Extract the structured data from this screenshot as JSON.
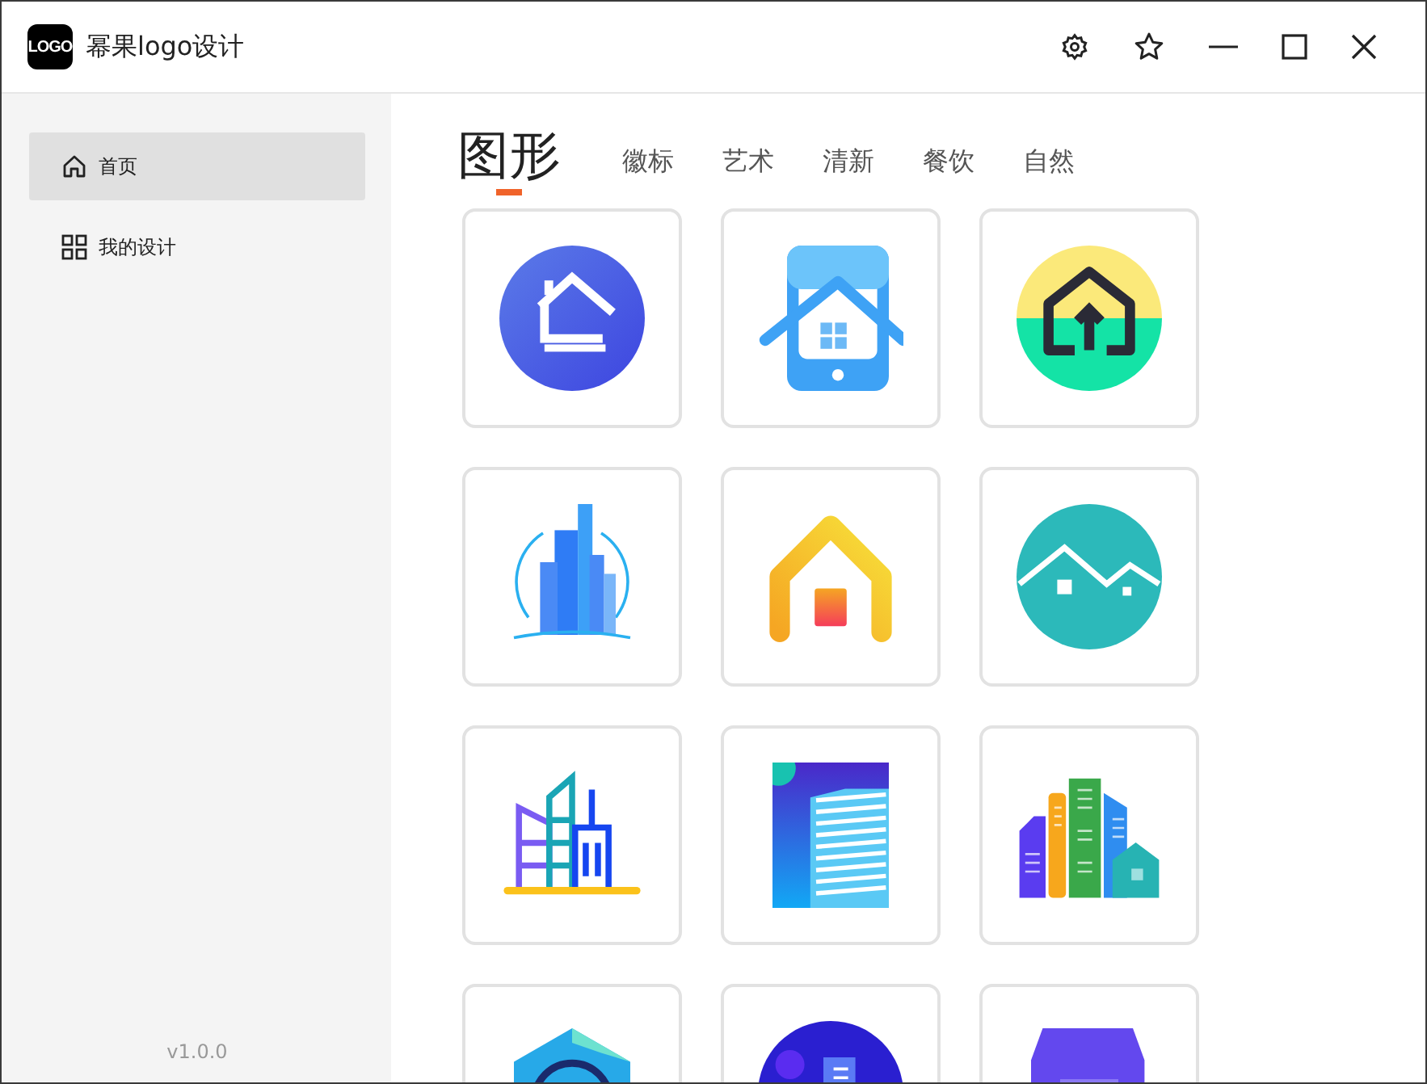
{
  "window": {
    "logo_text": "LOGO",
    "title": "幂果logo设计"
  },
  "sidebar": {
    "items": [
      {
        "label": "首页",
        "kind": "home",
        "selected": true
      },
      {
        "label": "我的设计",
        "kind": "grid",
        "selected": false
      }
    ],
    "version": "v1.0.0"
  },
  "tabs": [
    {
      "label": "图形",
      "selected": true
    },
    {
      "label": "徽标",
      "selected": false
    },
    {
      "label": "艺术",
      "selected": false
    },
    {
      "label": "清新",
      "selected": false
    },
    {
      "label": "餐饮",
      "selected": false
    },
    {
      "label": "自然",
      "selected": false
    }
  ],
  "templates": [
    {
      "kind": "house-circle"
    },
    {
      "kind": "phone-house"
    },
    {
      "kind": "house-arrow"
    },
    {
      "kind": "skyscraper"
    },
    {
      "kind": "house-gradient"
    },
    {
      "kind": "hills-houses"
    },
    {
      "kind": "city-outline"
    },
    {
      "kind": "tower-block"
    },
    {
      "kind": "city-color"
    },
    {
      "kind": "hexagon"
    },
    {
      "kind": "city-circle"
    },
    {
      "kind": "trapezoid"
    }
  ]
}
